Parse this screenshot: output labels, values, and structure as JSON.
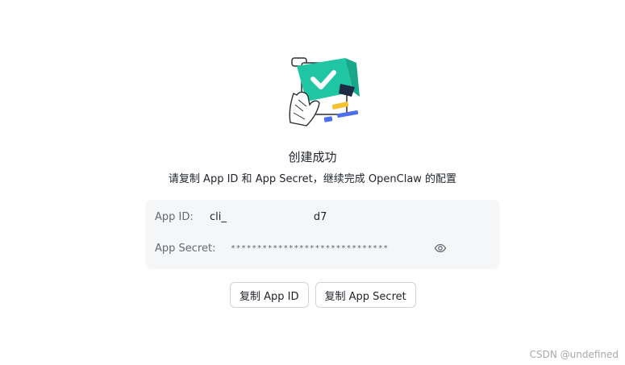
{
  "header": {
    "title": "创建成功",
    "subtitle": "请复制 App ID 和 App Secret，继续完成 OpenClaw 的配置"
  },
  "credentials": {
    "app_id_label": "App ID:",
    "app_id_prefix": "cli_",
    "app_id_suffix": "d7",
    "app_secret_label": "App Secret:",
    "app_secret_value": "******************************"
  },
  "actions": {
    "copy_app_id": "复制 App ID",
    "copy_app_secret": "复制 App Secret"
  },
  "watermark": "CSDN @undefined",
  "colors": {
    "accent_green": "#20c6a3",
    "accent_yellow": "#f7c231",
    "accent_blue": "#4e6ef2",
    "panel_bg": "#f5f6f7"
  }
}
